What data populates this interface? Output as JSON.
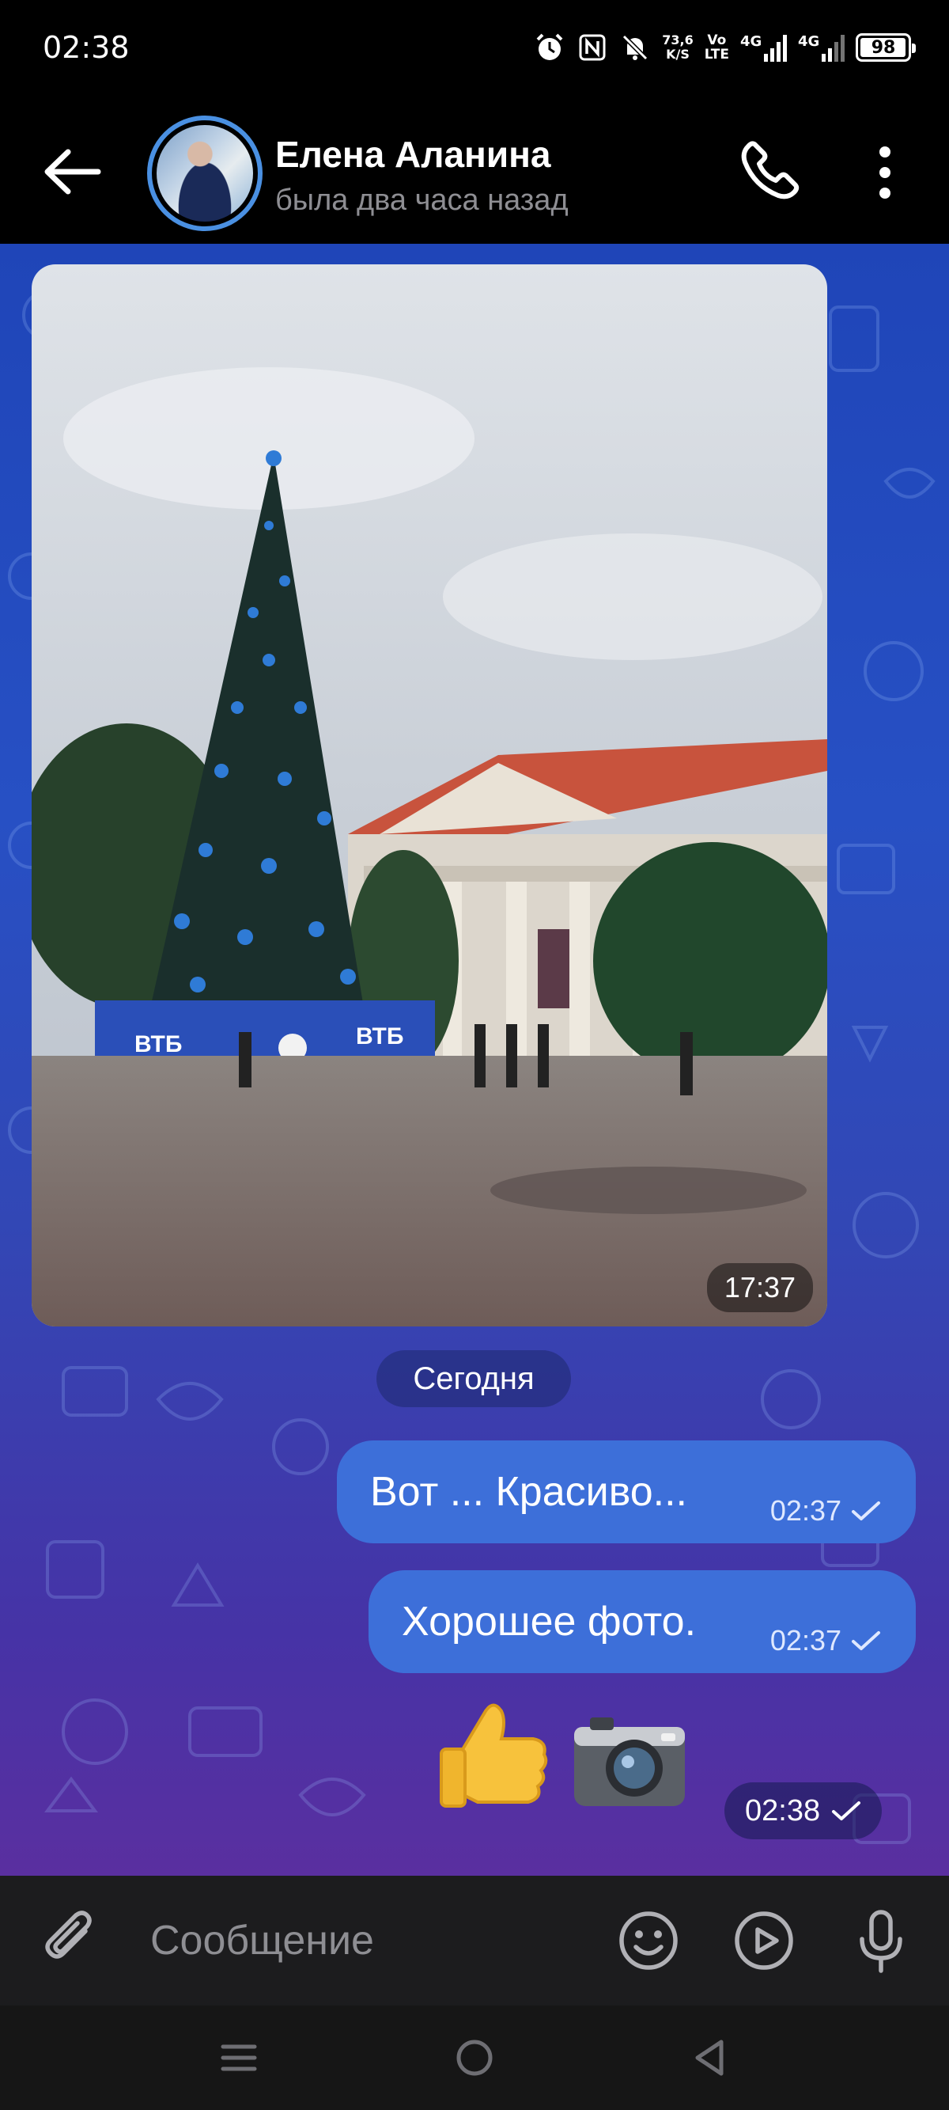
{
  "status_bar": {
    "time": "02:38",
    "net_speed_value": "73,6",
    "net_speed_unit": "K/S",
    "volte_top": "Vo",
    "volte_bottom": "LTE",
    "sim1_label": "4G",
    "sim2_label": "4G",
    "battery_level": "98",
    "battery_fraction": 0.98,
    "icons": [
      "alarm-icon",
      "nfc-icon",
      "mute-icon",
      "net-speed",
      "volte",
      "signal-1",
      "signal-2",
      "battery"
    ]
  },
  "header": {
    "contact_name": "Елена Аланина",
    "last_seen": "была два часа назад",
    "icons": [
      "back-arrow-icon",
      "avatar",
      "phone-icon",
      "more-vert-icon"
    ]
  },
  "chat": {
    "photo_message": {
      "time": "17:37",
      "image_description_icon": "photo-christmas-tree"
    },
    "date_separator": "Сегодня",
    "messages": [
      {
        "text": "Вот ... Красиво...",
        "time": "02:37",
        "status": "sent"
      },
      {
        "text": "Хорошее фото.",
        "time": "02:37",
        "status": "sent"
      }
    ],
    "emoji_message": {
      "emojis": [
        "👍",
        "📷"
      ],
      "time": "02:38",
      "status": "sent"
    }
  },
  "input": {
    "placeholder": "Сообщение",
    "icons": [
      "paperclip-icon",
      "smiley-icon",
      "video-note-icon",
      "mic-icon"
    ]
  },
  "nav_bar": {
    "icons": [
      "recents-icon",
      "home-icon",
      "back-icon"
    ]
  },
  "colors": {
    "accent": "#3d6fd9",
    "avatar_ring": "#4a90e2",
    "chat_bg_top": "#1f45b8",
    "chat_bg_bottom": "#5a2fa0",
    "header_bg": "#000000",
    "input_bg": "#1c1c1e"
  }
}
